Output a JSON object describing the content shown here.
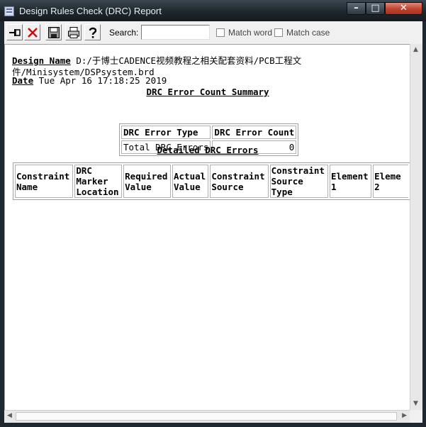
{
  "window": {
    "title": "Design Rules Check (DRC) Report",
    "minimize_glyph": "–",
    "maximize_glyph": "□",
    "close_glyph": "✕"
  },
  "toolbar": {
    "buttons": [
      "pin-icon",
      "close-x-icon",
      "save-icon",
      "print-icon",
      "help-icon"
    ],
    "search_label": "Search:",
    "search_value": "",
    "match_word_label": "Match word",
    "match_case_label": "Match case"
  },
  "report": {
    "design_name_label": "Design Name",
    "design_name_value_line1": "D:/于博士CADENCE视频教程之相关配套资料/PCB工程文",
    "design_name_value_line2": "件/Minisystem/DSPsystem.brd",
    "date_label": "Date",
    "date_value": "Tue Apr 16 17:18:25 2019",
    "summary_title": "DRC Error Count Summary",
    "summary_headers": [
      "DRC Error Type",
      "DRC Error Count"
    ],
    "summary_rows": [
      {
        "type": "Total DRC Errors",
        "count": "0"
      }
    ],
    "detailed_title": "Detailed DRC Errors",
    "detailed_headers": [
      [
        "Constraint",
        "Name"
      ],
      [
        "DRC",
        "Marker",
        "Location"
      ],
      [
        "Required",
        "Value"
      ],
      [
        "Actual",
        "Value"
      ],
      [
        "Constraint",
        "Source"
      ],
      [
        "Constraint",
        "Source",
        "Type"
      ],
      [
        "Element",
        "1"
      ],
      [
        "Eleme",
        "2"
      ]
    ]
  },
  "colors": {
    "titlebar": "#1f262d",
    "close_button": "#c0432d",
    "content_bg": "#ffffff",
    "chrome_bg": "#f0f0f0"
  }
}
